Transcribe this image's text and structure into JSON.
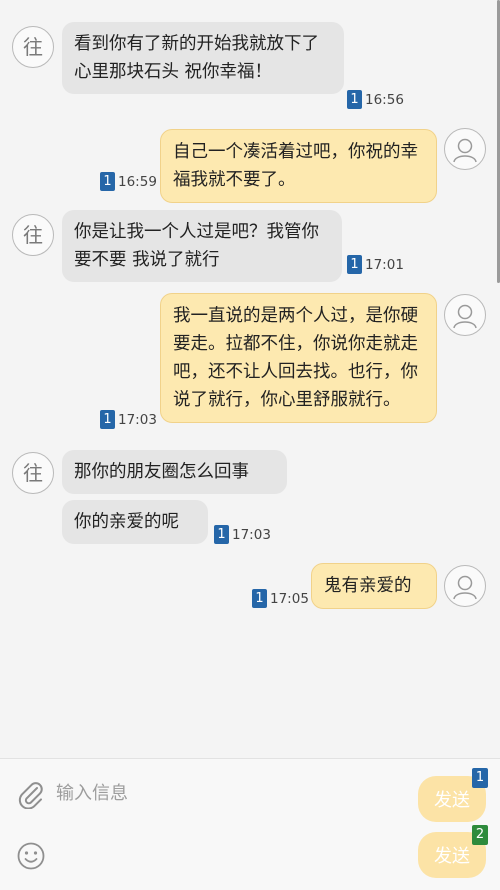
{
  "contact": {
    "avatar_char": "往"
  },
  "messages": [
    {
      "dir": "in",
      "text": "看到你有了新的开始我就放下了心里那块石头 祝你幸福！",
      "sim": "1",
      "time": "16:56"
    },
    {
      "dir": "out",
      "text": "自己一个凑活着过吧，你祝的幸福我就不要了。",
      "sim": "1",
      "time": "16:59"
    },
    {
      "dir": "in",
      "text": "你是让我一个人过是吧？我管你要不要 我说了就行",
      "sim": "1",
      "time": "17:01"
    },
    {
      "dir": "out",
      "text": "我一直说的是两个人过，是你硬要走。拉都不住，你说你走就走吧，还不让人回去找。也行，你说了就行，你心里舒服就行。",
      "sim": "1",
      "time": "17:03"
    },
    {
      "dir": "in",
      "text": "那你的朋友圈怎么回事",
      "sim": "",
      "time": ""
    },
    {
      "dir": "in",
      "text": "你的亲爱的呢",
      "sim": "1",
      "time": "17:03"
    },
    {
      "dir": "out",
      "text": "鬼有亲爱的",
      "sim": "1",
      "time": "17:05"
    }
  ],
  "composer": {
    "placeholder": "输入信息",
    "send_sim1": {
      "label": "发送",
      "sim": "1",
      "color": "#2566a8"
    },
    "send_sim2": {
      "label": "发送",
      "sim": "2",
      "color": "#2e8b3c"
    }
  },
  "icons": {
    "attach": "paperclip-icon",
    "emoji": "smiley-icon",
    "user": "user-avatar-icon"
  }
}
